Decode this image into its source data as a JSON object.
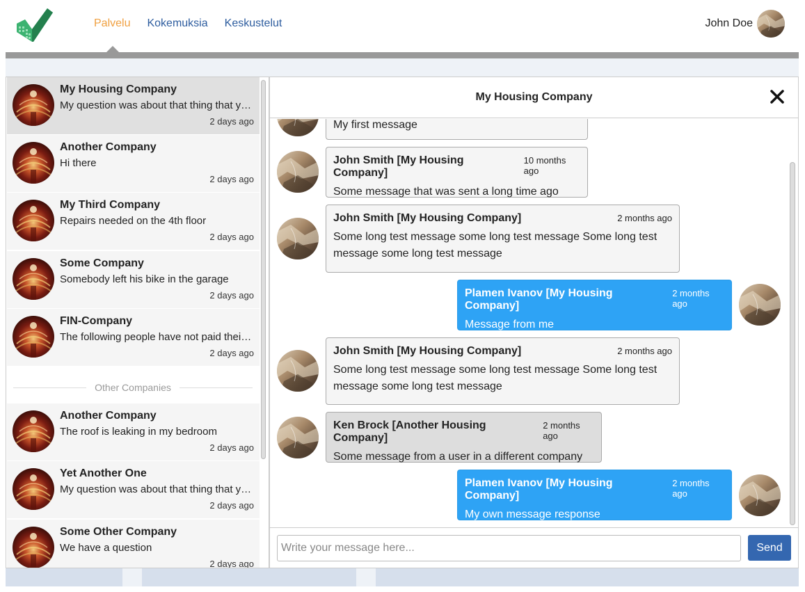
{
  "header": {
    "nav": [
      {
        "label": "Palvelu",
        "active": true
      },
      {
        "label": "Kokemuksia",
        "active": false
      },
      {
        "label": "Keskustelut",
        "active": false
      }
    ],
    "user_name": "John Doe"
  },
  "conversations": [
    {
      "name": "My Housing Company",
      "preview": "My question was about that thing that you said the other day",
      "time": "2 days ago",
      "selected": true
    },
    {
      "name": "Another Company",
      "preview": "Hi there",
      "time": "2 days ago"
    },
    {
      "name": "My Third Company",
      "preview": "Repairs needed on the 4th floor",
      "time": "2 days ago"
    },
    {
      "name": "Some Company",
      "preview": "Somebody left his bike in the garage",
      "time": "2 days ago"
    },
    {
      "name": "FIN-Company",
      "preview": "The following people have not paid their rent this month",
      "time": "2 days ago"
    }
  ],
  "other_label": "Other Companies",
  "other_conversations": [
    {
      "name": "Another Company",
      "preview": "The roof is leaking in my bedroom",
      "time": "2 days ago"
    },
    {
      "name": "Yet Another One",
      "preview": "My question was about that thing that you said the other day",
      "time": "2 days ago"
    },
    {
      "name": "Some Other Company",
      "preview": "We have a question",
      "time": "2 days ago"
    }
  ],
  "chat": {
    "title": "My Housing Company",
    "messages": [
      {
        "author": "",
        "time": "",
        "text": "My first message",
        "kind": "other"
      },
      {
        "author": "John Smith [My Housing Company]",
        "time": "10 months ago",
        "text": "Some message that was sent a long time ago",
        "kind": "other"
      },
      {
        "author": "John Smith [My Housing Company]",
        "time": "2 months ago",
        "text": "Some long test message some long test message Some long test message some long test message",
        "kind": "other"
      },
      {
        "author": "Plamen Ivanov [My Housing Company]",
        "time": "2 months ago",
        "text": "Message from me",
        "kind": "mine"
      },
      {
        "author": "John Smith [My Housing Company]",
        "time": "2 months ago",
        "text": "Some long test message some long test message Some long test message some long test message",
        "kind": "other"
      },
      {
        "author": "Ken Brock [Another Housing Company]",
        "time": "2 months ago",
        "text": "Some message from a user in a different company",
        "kind": "diff"
      },
      {
        "author": "Plamen Ivanov [My Housing Company]",
        "time": "2 months ago",
        "text": "My own message response",
        "kind": "mine"
      }
    ],
    "input_placeholder": "Write your message here...",
    "send_label": "Send"
  },
  "colors": {
    "nav_active": "#f0a040",
    "nav_link": "#2e5d9f",
    "my_bubble": "#2ea3f5",
    "send_button": "#3467b0",
    "logo_green": "#3cb371"
  },
  "icons": {
    "logo": "checkmark-building-logo",
    "close": "close-icon"
  }
}
